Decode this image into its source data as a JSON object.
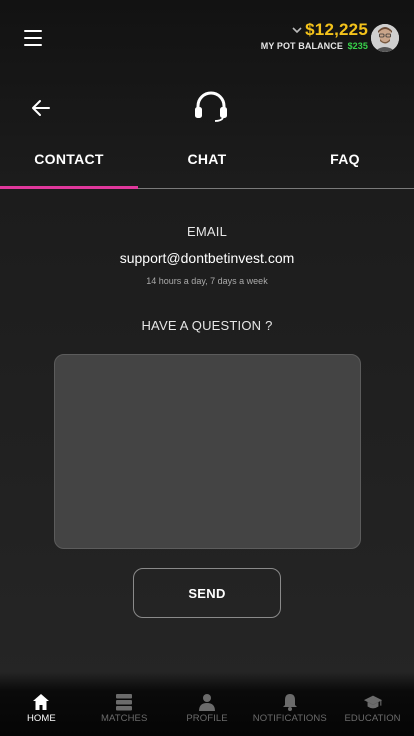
{
  "header": {
    "balance": "$12,225",
    "pot_label": "MY POT BALANCE",
    "pot_value": "$235"
  },
  "tabs": [
    {
      "label": "CONTACT",
      "active": true
    },
    {
      "label": "CHAT",
      "active": false
    },
    {
      "label": "FAQ",
      "active": false
    }
  ],
  "contact": {
    "email_label": "EMAIL",
    "email": "support@dontbetinvest.com",
    "hours": "14 hours a day, 7 days a week",
    "question_label": "HAVE A QUESTION ?",
    "message_value": "",
    "send_label": "SEND"
  },
  "nav": [
    {
      "label": "HOME",
      "icon": "home-icon",
      "active": true
    },
    {
      "label": "MATCHES",
      "icon": "matches-icon",
      "active": false
    },
    {
      "label": "PROFILE",
      "icon": "profile-icon",
      "active": false
    },
    {
      "label": "NOTIFICATIONS",
      "icon": "bell-icon",
      "active": false
    },
    {
      "label": "EDUCATION",
      "icon": "graduation-cap-icon",
      "active": false
    }
  ],
  "colors": {
    "balance": "#f3c21b",
    "pot_value": "#37d24a",
    "tab_indicator": "#e0389c"
  }
}
